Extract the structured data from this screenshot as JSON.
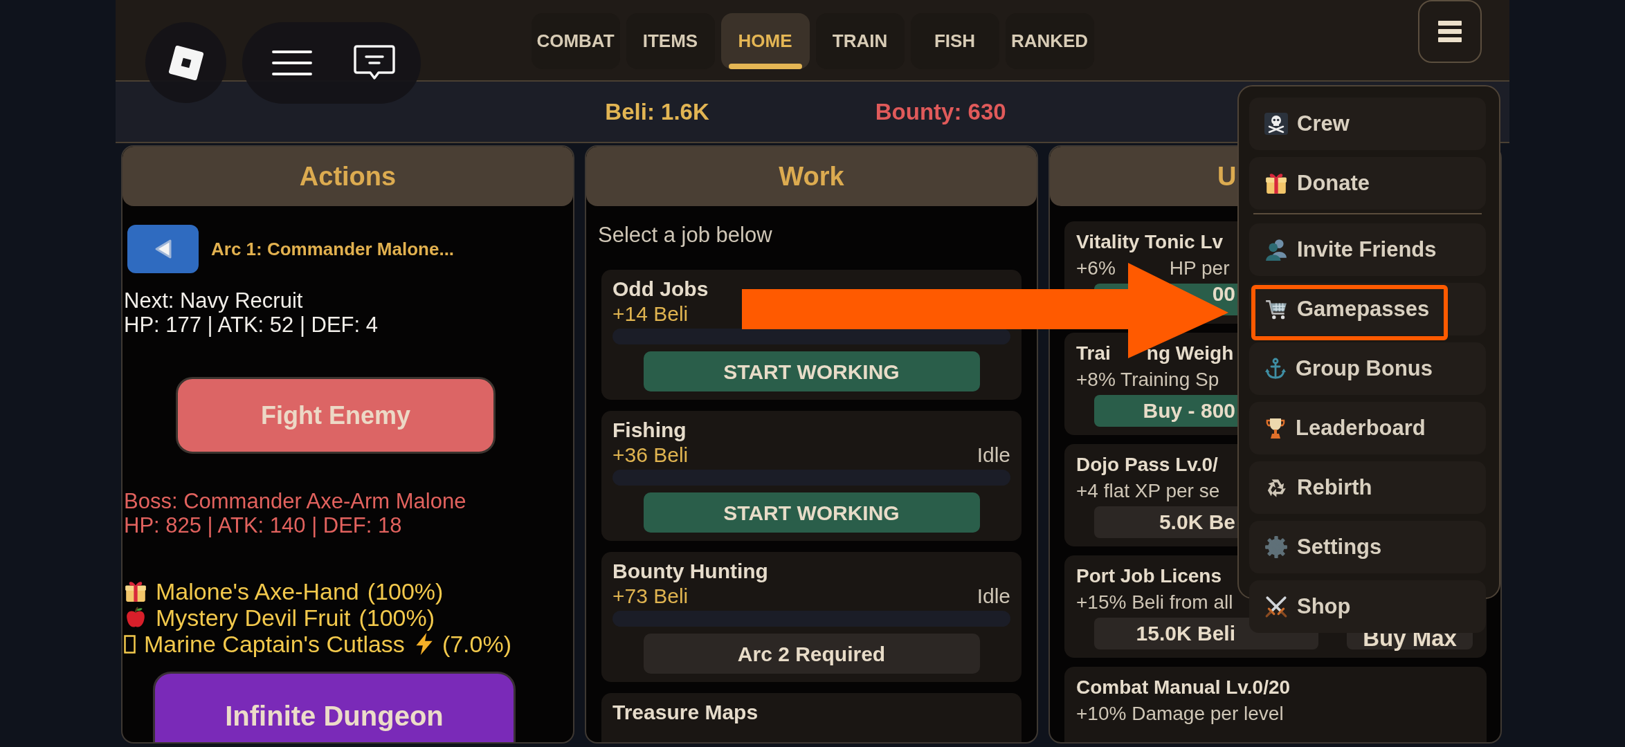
{
  "topbar": {
    "tabs": [
      {
        "label": "COMBAT",
        "selected": false
      },
      {
        "label": "ITEMS",
        "selected": false
      },
      {
        "label": "HOME",
        "selected": true
      },
      {
        "label": "TRAIN",
        "selected": false
      },
      {
        "label": "FISH",
        "selected": false
      },
      {
        "label": "RANKED",
        "selected": false
      }
    ]
  },
  "stats": [
    {
      "text": "Beli: 1.6K",
      "color": "#e2b553"
    },
    {
      "text": "Bounty: 630",
      "color": "#e05a5a"
    }
  ],
  "panels": [
    {
      "kind": "actions",
      "title": "Actions",
      "arc_title": "Arc 1: Commander Malone...",
      "next_enemy": [
        "Next: Navy Recruit",
        "HP: 177 | ATK: 52 | DEF: 4"
      ],
      "fight_button": "Fight Enemy",
      "boss": [
        "Boss: Commander Axe-Arm Malone",
        "HP: 825 | ATK: 140 | DEF: 18"
      ],
      "drops": [
        {
          "name": "Malone's Axe-Hand",
          "chance": "(100%)",
          "rare": false
        },
        {
          "name": "Mystery Devil Fruit",
          "chance": "(100%)",
          "rare": false
        },
        {
          "name": "Marine Captain's Cutlass",
          "chance": "(7.0%)",
          "rare": true
        }
      ],
      "dungeon_button": "Infinite Dungeon"
    },
    {
      "kind": "work",
      "title": "Work",
      "hint": "Select a job below",
      "jobs": [
        {
          "name": "Odd Jobs",
          "reward": "+14 Beli",
          "button": {
            "label": "START WORKING",
            "disabled": false
          }
        },
        {
          "name": "Fishing",
          "reward": "+36 Beli",
          "status": "Idle",
          "button": {
            "label": "START WORKING",
            "disabled": false
          }
        },
        {
          "name": "Bounty Hunting",
          "reward": "+73 Beli",
          "status": "Idle",
          "button": {
            "label": "Arc 2 Required",
            "disabled": true
          }
        },
        {
          "name": "Treasure Maps"
        }
      ]
    },
    {
      "kind": "upgrades",
      "title": "U",
      "upgrades": [
        {
          "title": "Vitality Tonic Lv",
          "description": [
            "+6%",
            "HP per"
          ],
          "buttons": [
            {
              "label": "00",
              "disabled": false
            }
          ]
        },
        {
          "title": [
            "Trai",
            "ng Weigh"
          ],
          "description": "+8% Training Sp",
          "buttons": [
            {
              "label": "Buy - 800",
              "disabled": false
            }
          ]
        },
        {
          "title": "Dojo Pass Lv.0/",
          "description": "+4 flat XP per se",
          "buttons": [
            {
              "label": "5.0K Be",
              "disabled": true
            }
          ]
        },
        {
          "title": "Port Job Licens",
          "description": "+15% Beli from all",
          "buttons": [
            {
              "label": "15.0K Beli",
              "disabled": true
            },
            {
              "label": "Buy Max",
              "disabled": true
            }
          ]
        },
        {
          "title": "Combat Manual Lv.0/20",
          "description": "+10% Damage per level"
        }
      ]
    }
  ],
  "menu": {
    "sections": [
      {
        "items": [
          {
            "label": "Crew",
            "highlighted": false
          },
          {
            "label": "Donate",
            "highlighted": false
          }
        ]
      },
      {
        "items": [
          {
            "label": "Invite Friends",
            "highlighted": false
          },
          {
            "label": "Gamepasses",
            "highlighted": true
          },
          {
            "label": "Group Bonus",
            "highlighted": false
          },
          {
            "label": "Leaderboard",
            "highlighted": false
          },
          {
            "label": "Rebirth",
            "highlighted": false
          },
          {
            "label": "Settings",
            "highlighted": false
          },
          {
            "label": "Shop",
            "highlighted": false
          }
        ]
      }
    ]
  }
}
